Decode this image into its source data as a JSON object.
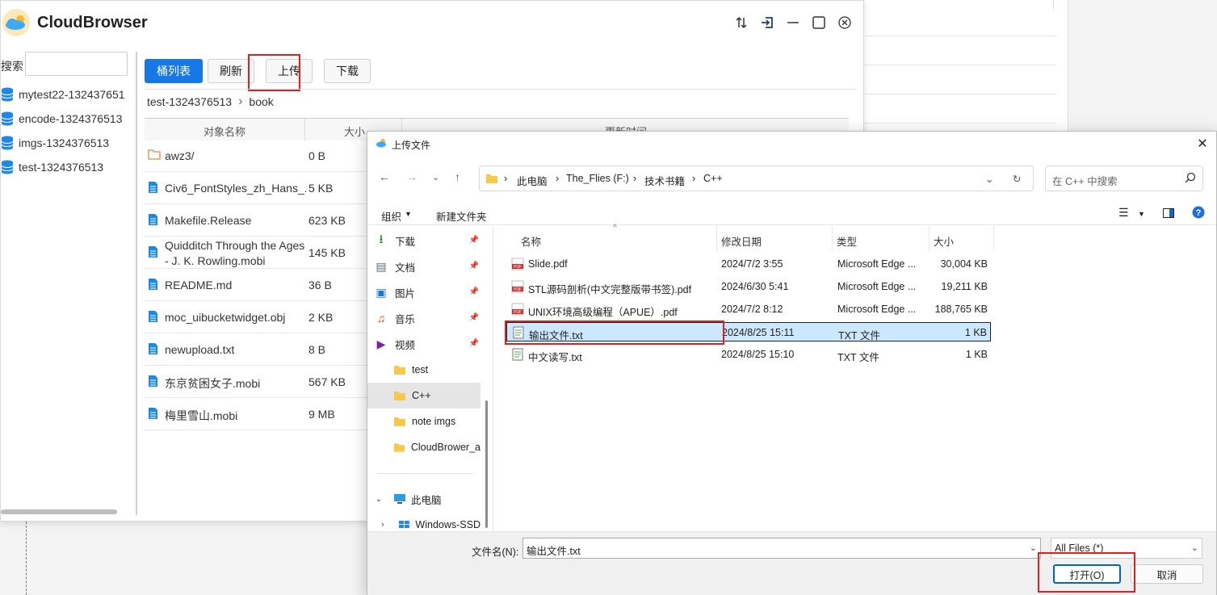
{
  "app": {
    "title": "CloudBrowser",
    "search_label": "搜索",
    "buckets": [
      "mytest22-132437651",
      "encode-1324376513",
      "imgs-1324376513",
      "test-1324376513"
    ],
    "toolbar": {
      "bucket_list": "桶列表",
      "refresh": "刷新",
      "upload": "上传",
      "download": "下载"
    },
    "breadcrumb": [
      "test-1324376513",
      "book"
    ],
    "columns": [
      "对象名称",
      "大小",
      "更新时间"
    ],
    "objects": [
      {
        "name": "awz3/",
        "size": "0 B",
        "type": "folder"
      },
      {
        "name": "Civ6_FontStyles_zh_Hans_...",
        "size": "5 KB",
        "type": "file"
      },
      {
        "name": "Makefile.Release",
        "size": "623 KB",
        "type": "file"
      },
      {
        "name": "Quidditch Through the Ages - J. K. Rowling.mobi",
        "size": "145 KB",
        "type": "file"
      },
      {
        "name": "README.md",
        "size": "36 B",
        "type": "file"
      },
      {
        "name": "moc_uibucketwidget.obj",
        "size": "2 KB",
        "type": "file"
      },
      {
        "name": "newupload.txt",
        "size": "8 B",
        "type": "file"
      },
      {
        "name": "东京贫困女子.mobi",
        "size": "567 KB",
        "type": "file"
      },
      {
        "name": "梅里雪山.mobi",
        "size": "9 MB",
        "type": "file"
      }
    ]
  },
  "dialog": {
    "title": "上传文件",
    "address": [
      "此电脑",
      "The_Flies (F:)",
      "技术书籍",
      "C++"
    ],
    "search_placeholder": "在 C++ 中搜索",
    "organize": "组织",
    "new_folder": "新建文件夹",
    "nav": [
      {
        "label": "下载",
        "pinned": true
      },
      {
        "label": "文档",
        "pinned": true
      },
      {
        "label": "图片",
        "pinned": true
      },
      {
        "label": "音乐",
        "pinned": true
      },
      {
        "label": "视频",
        "pinned": true
      },
      {
        "label": "test",
        "pinned": false
      },
      {
        "label": "C++",
        "pinned": false
      },
      {
        "label": "note imgs",
        "pinned": false
      },
      {
        "label": "CloudBrower_a",
        "pinned": false
      },
      {
        "label": "此电脑",
        "pinned": false
      },
      {
        "label": "Windows-SSD",
        "pinned": false
      }
    ],
    "columns": [
      "名称",
      "修改日期",
      "类型",
      "大小"
    ],
    "files": [
      {
        "name": "Slide.pdf",
        "date": "2024/7/2 3:55",
        "type": "Microsoft Edge ...",
        "size": "30,004 KB",
        "kind": "pdf"
      },
      {
        "name": "STL源码剖析(中文完整版带书签).pdf",
        "date": "2024/6/30 5:41",
        "type": "Microsoft Edge ...",
        "size": "19,211 KB",
        "kind": "pdf"
      },
      {
        "name": "UNIX环境高级编程（APUE）.pdf",
        "date": "2024/7/2 8:12",
        "type": "Microsoft Edge ...",
        "size": "188,765 KB",
        "kind": "pdf"
      },
      {
        "name": "输出文件.txt",
        "date": "2024/8/25 15:11",
        "type": "TXT 文件",
        "size": "1 KB",
        "kind": "txt"
      },
      {
        "name": "中文读写.txt",
        "date": "2024/8/25 15:10",
        "type": "TXT 文件",
        "size": "1 KB",
        "kind": "txt"
      }
    ],
    "filename_label": "文件名(N):",
    "filename_value": "输出文件.txt",
    "filetype": "All Files (*)",
    "open_label": "打开(O)",
    "cancel_label": "取消"
  }
}
